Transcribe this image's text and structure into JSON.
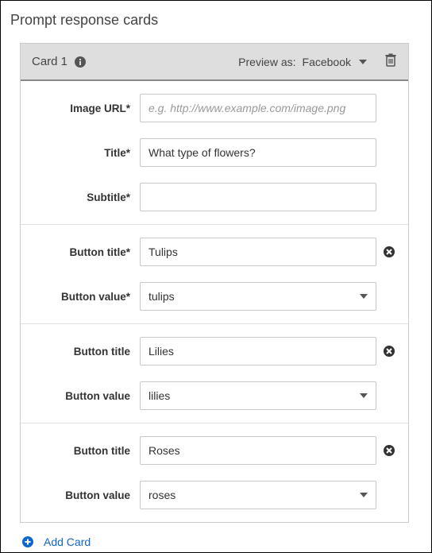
{
  "page_title": "Prompt response cards",
  "header": {
    "card_label": "Card 1",
    "preview_label": "Preview as:",
    "preview_value": "Facebook"
  },
  "section_basic": {
    "rows": [
      {
        "label": "Image URL*",
        "value": "",
        "placeholder": "e.g. http://www.example.com/image.png"
      },
      {
        "label": "Title*",
        "value": "What type of flowers?",
        "placeholder": ""
      },
      {
        "label": "Subtitle*",
        "value": "",
        "placeholder": ""
      }
    ]
  },
  "buttons": [
    {
      "title_label": "Button title*",
      "title_value": "Tulips",
      "value_label": "Button value*",
      "value_value": "tulips"
    },
    {
      "title_label": "Button title",
      "title_value": "Lilies",
      "value_label": "Button value",
      "value_value": "lilies"
    },
    {
      "title_label": "Button title",
      "title_value": "Roses",
      "value_label": "Button value",
      "value_value": "roses"
    }
  ],
  "add_card_label": "Add Card"
}
